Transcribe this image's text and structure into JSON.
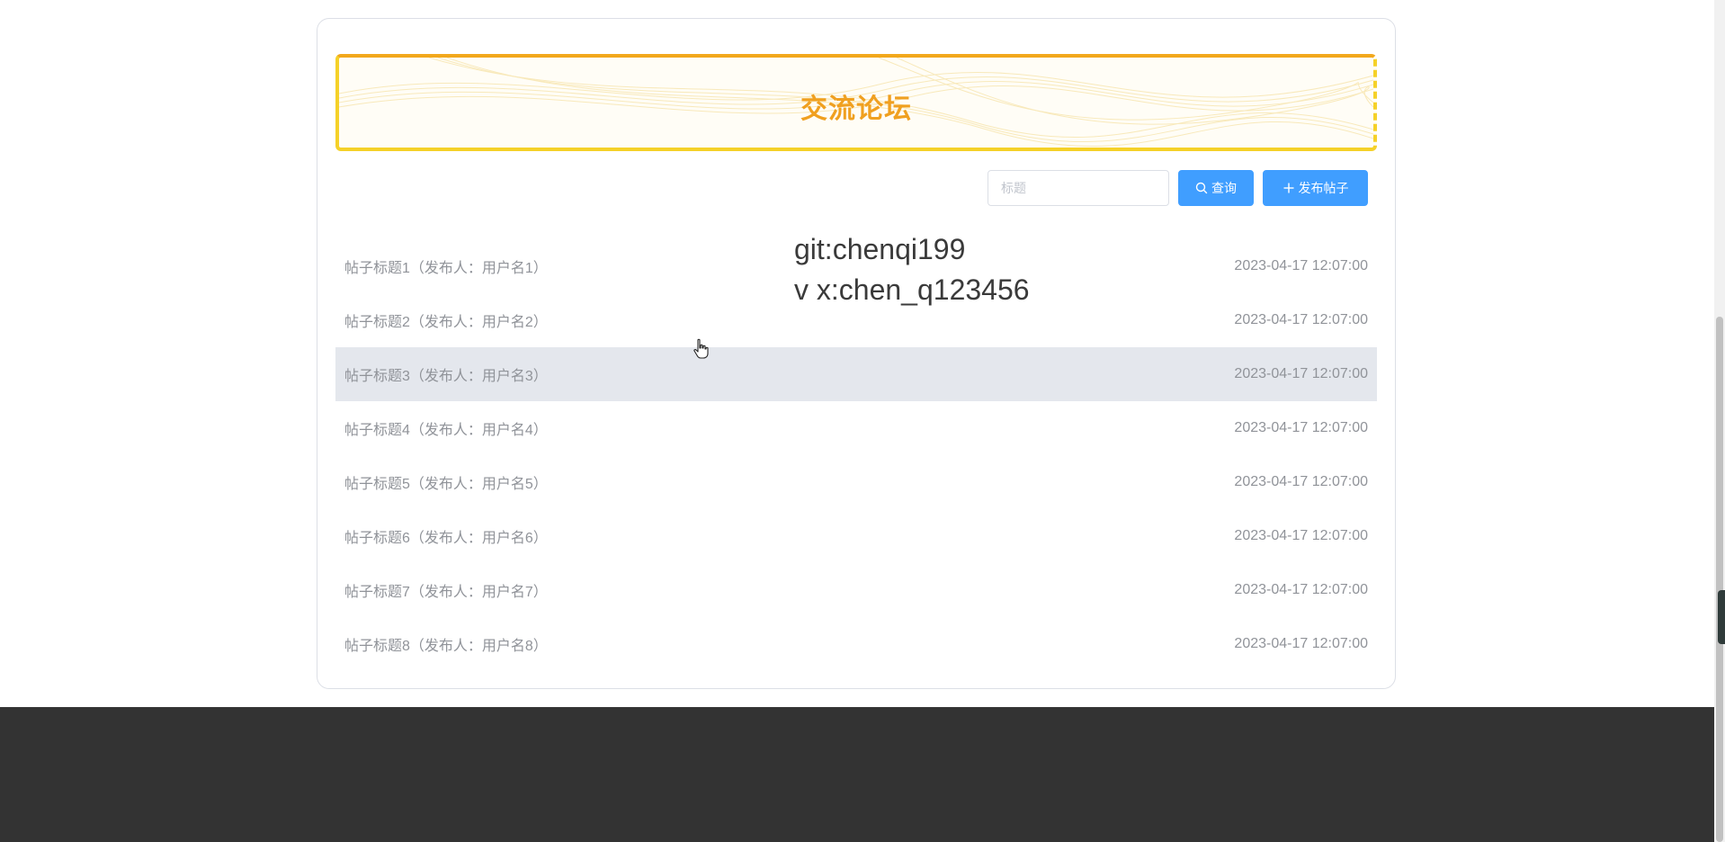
{
  "banner": {
    "title": "交流论坛"
  },
  "search": {
    "placeholder": "标题",
    "value": ""
  },
  "buttons": {
    "query_label": "查询",
    "publish_label": "发布帖子"
  },
  "posts": [
    {
      "title": "帖子标题1（发布人：用户名1）",
      "time": "2023-04-17 12:07:00"
    },
    {
      "title": "帖子标题2（发布人：用户名2）",
      "time": "2023-04-17 12:07:00"
    },
    {
      "title": "帖子标题3（发布人：用户名3）",
      "time": "2023-04-17 12:07:00"
    },
    {
      "title": "帖子标题4（发布人：用户名4）",
      "time": "2023-04-17 12:07:00"
    },
    {
      "title": "帖子标题5（发布人：用户名5）",
      "time": "2023-04-17 12:07:00"
    },
    {
      "title": "帖子标题6（发布人：用户名6）",
      "time": "2023-04-17 12:07:00"
    },
    {
      "title": "帖子标题7（发布人：用户名7）",
      "time": "2023-04-17 12:07:00"
    },
    {
      "title": "帖子标题8（发布人：用户名8）",
      "time": "2023-04-17 12:07:00"
    }
  ],
  "overlay": {
    "line1": "git:chenqi199",
    "line2": "v x:chen_q123456"
  },
  "colors": {
    "accent": "#409eff",
    "banner_title": "#f0a020",
    "footer": "#333333",
    "row_hover": "#e4e7ed"
  },
  "icons": {
    "query": "search-icon",
    "publish": "plus-icon"
  }
}
